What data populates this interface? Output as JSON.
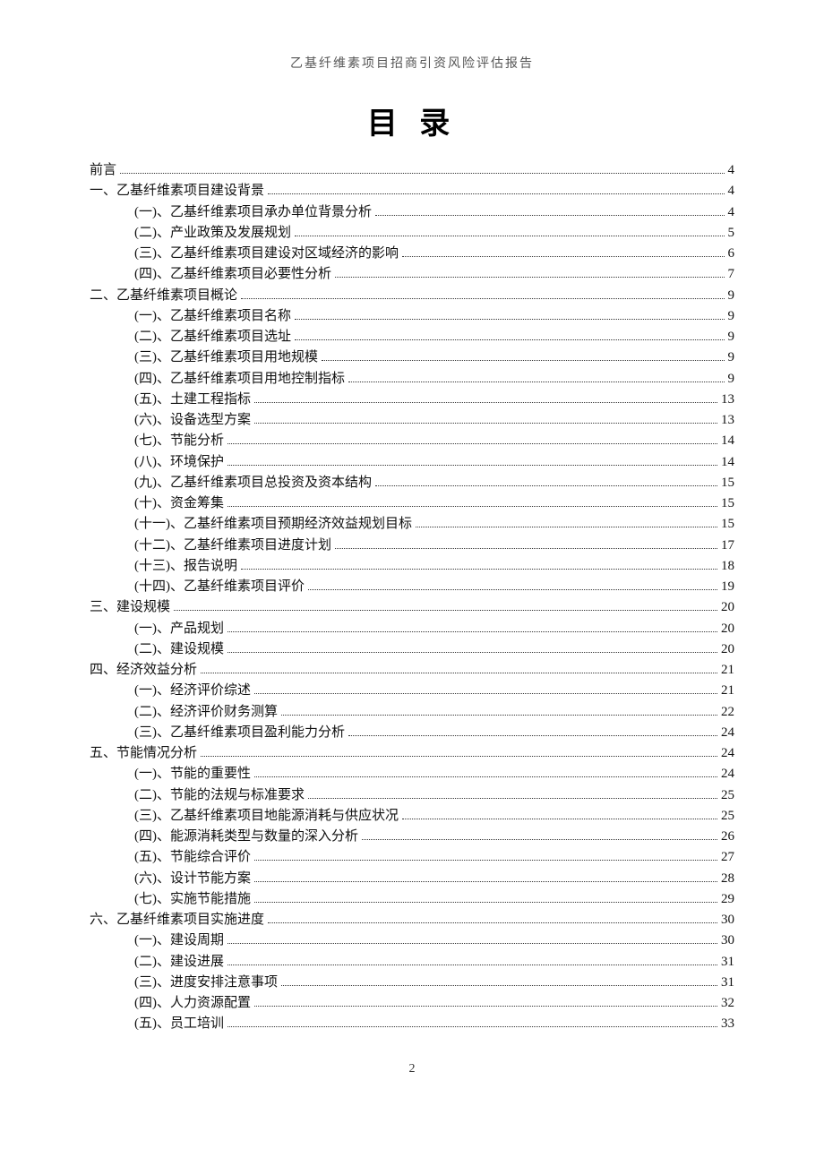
{
  "header": "乙基纤维素项目招商引资风险评估报告",
  "title": "目 录",
  "page_number": "2",
  "toc": [
    {
      "level": 1,
      "label": "前言",
      "page": "4"
    },
    {
      "level": 1,
      "label": "一、乙基纤维素项目建设背景",
      "page": "4"
    },
    {
      "level": 2,
      "label": "(一)、乙基纤维素项目承办单位背景分析",
      "page": "4"
    },
    {
      "level": 2,
      "label": "(二)、产业政策及发展规划",
      "page": "5"
    },
    {
      "level": 2,
      "label": "(三)、乙基纤维素项目建设对区域经济的影响",
      "page": "6"
    },
    {
      "level": 2,
      "label": "(四)、乙基纤维素项目必要性分析",
      "page": "7"
    },
    {
      "level": 1,
      "label": "二、乙基纤维素项目概论",
      "page": "9"
    },
    {
      "level": 2,
      "label": "(一)、乙基纤维素项目名称",
      "page": "9"
    },
    {
      "level": 2,
      "label": "(二)、乙基纤维素项目选址",
      "page": "9"
    },
    {
      "level": 2,
      "label": "(三)、乙基纤维素项目用地规模",
      "page": "9"
    },
    {
      "level": 2,
      "label": "(四)、乙基纤维素项目用地控制指标",
      "page": "9"
    },
    {
      "level": 2,
      "label": "(五)、土建工程指标",
      "page": "13"
    },
    {
      "level": 2,
      "label": "(六)、设备选型方案",
      "page": "13"
    },
    {
      "level": 2,
      "label": "(七)、节能分析",
      "page": "14"
    },
    {
      "level": 2,
      "label": "(八)、环境保护",
      "page": "14"
    },
    {
      "level": 2,
      "label": "(九)、乙基纤维素项目总投资及资本结构",
      "page": "15"
    },
    {
      "level": 2,
      "label": "(十)、资金筹集",
      "page": "15"
    },
    {
      "level": 2,
      "label": "(十一)、乙基纤维素项目预期经济效益规划目标",
      "page": "15"
    },
    {
      "level": 2,
      "label": "(十二)、乙基纤维素项目进度计划",
      "page": "17"
    },
    {
      "level": 2,
      "label": "(十三)、报告说明",
      "page": "18"
    },
    {
      "level": 2,
      "label": "(十四)、乙基纤维素项目评价",
      "page": "19"
    },
    {
      "level": 1,
      "label": "三、建设规模",
      "page": "20"
    },
    {
      "level": 2,
      "label": "(一)、产品规划",
      "page": "20"
    },
    {
      "level": 2,
      "label": "(二)、建设规模",
      "page": "20"
    },
    {
      "level": 1,
      "label": "四、经济效益分析",
      "page": "21"
    },
    {
      "level": 2,
      "label": "(一)、经济评价综述",
      "page": "21"
    },
    {
      "level": 2,
      "label": "(二)、经济评价财务测算",
      "page": "22"
    },
    {
      "level": 2,
      "label": "(三)、乙基纤维素项目盈利能力分析",
      "page": "24"
    },
    {
      "level": 1,
      "label": "五、节能情况分析",
      "page": "24"
    },
    {
      "level": 2,
      "label": "(一)、节能的重要性",
      "page": "24"
    },
    {
      "level": 2,
      "label": "(二)、节能的法规与标准要求",
      "page": "25"
    },
    {
      "level": 2,
      "label": "(三)、乙基纤维素项目地能源消耗与供应状况",
      "page": "25"
    },
    {
      "level": 2,
      "label": "(四)、能源消耗类型与数量的深入分析",
      "page": "26"
    },
    {
      "level": 2,
      "label": "(五)、节能综合评价",
      "page": "27"
    },
    {
      "level": 2,
      "label": "(六)、设计节能方案",
      "page": "28"
    },
    {
      "level": 2,
      "label": "(七)、实施节能措施",
      "page": "29"
    },
    {
      "level": 1,
      "label": "六、乙基纤维素项目实施进度",
      "page": "30"
    },
    {
      "level": 2,
      "label": "(一)、建设周期",
      "page": "30"
    },
    {
      "level": 2,
      "label": "(二)、建设进展",
      "page": "31"
    },
    {
      "level": 2,
      "label": "(三)、进度安排注意事项",
      "page": "31"
    },
    {
      "level": 2,
      "label": "(四)、人力资源配置",
      "page": "32"
    },
    {
      "level": 2,
      "label": "(五)、员工培训",
      "page": "33"
    }
  ]
}
